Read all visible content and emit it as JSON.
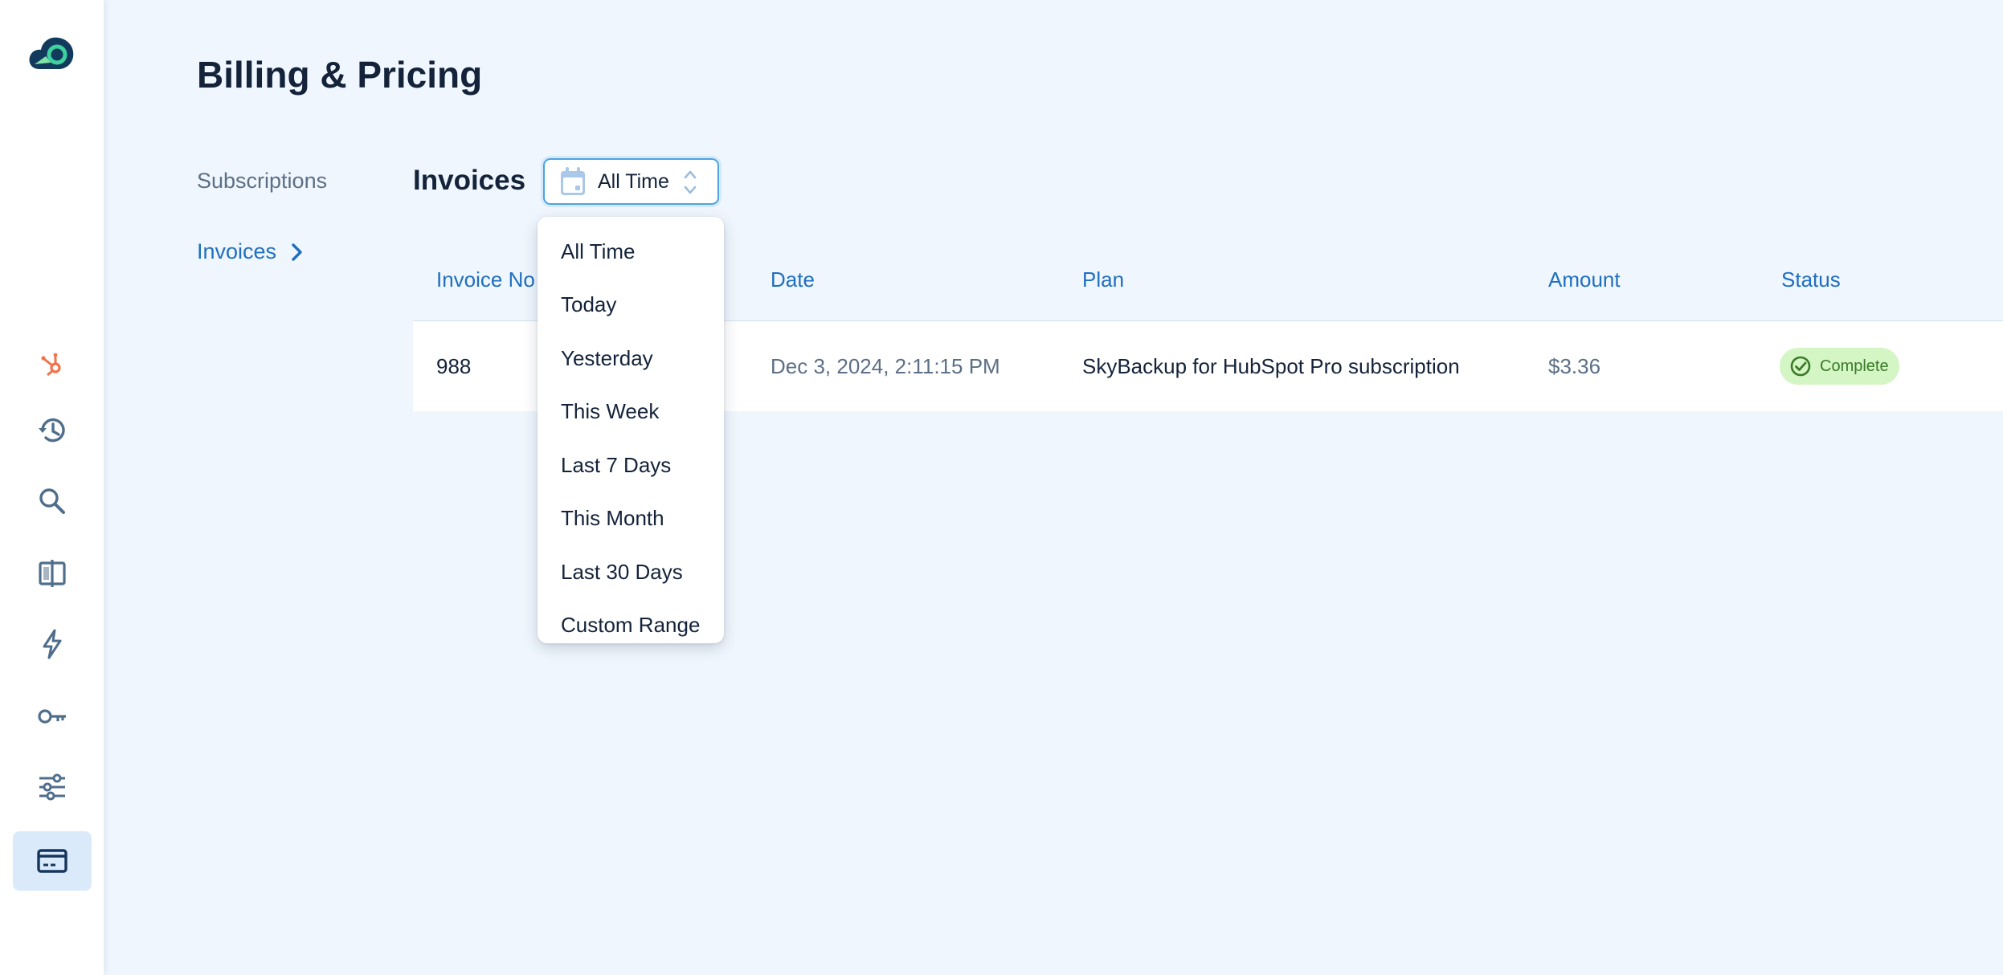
{
  "page": {
    "title": "Billing & Pricing"
  },
  "subnav": {
    "subscriptions": "Subscriptions",
    "invoices": "Invoices"
  },
  "section": {
    "title": "Invoices"
  },
  "filter": {
    "selected": "All Time"
  },
  "dropdown": {
    "options": [
      "All Time",
      "Today",
      "Yesterday",
      "This Week",
      "Last 7 Days",
      "This Month",
      "Last 30 Days",
      "Custom Range"
    ]
  },
  "table": {
    "columns": [
      "Invoice No",
      "Date",
      "Plan",
      "Amount",
      "Status"
    ],
    "rows": [
      {
        "invoice_no": "988",
        "date": "Dec 3, 2024, 2:11:15 PM",
        "plan": "SkyBackup for HubSpot Pro subscription",
        "amount": "$3.36",
        "status": "Complete"
      }
    ]
  },
  "sidebar": {
    "icons": [
      "hubspot-icon",
      "history-icon",
      "search-icon",
      "compare-icon",
      "lightning-icon",
      "key-icon",
      "sliders-icon",
      "credit-card-icon"
    ],
    "active": "credit-card-icon"
  },
  "colors": {
    "accent": "#1f6fc0",
    "background": "#eff6fd",
    "active_nav": "#dbeafb",
    "hubspot_orange": "#f2724a",
    "complete_bg": "#d4f5c4",
    "complete_text": "#3a7a2a"
  }
}
